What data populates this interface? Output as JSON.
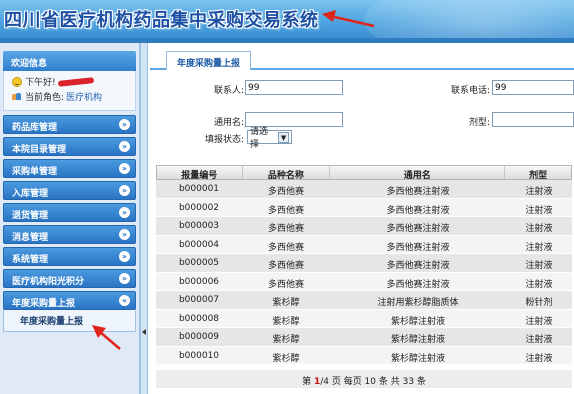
{
  "header": {
    "title": "四川省医疗机构药品集中采购交易系统"
  },
  "sidebar": {
    "welcome_title": "欢迎信息",
    "greeting": "下午好!",
    "role_label": "当前角色:",
    "role_value": "医疗机构",
    "menu": [
      {
        "label": "药品库管理"
      },
      {
        "label": "本院目录管理"
      },
      {
        "label": "采购单管理"
      },
      {
        "label": "入库管理"
      },
      {
        "label": "退货管理"
      },
      {
        "label": "消息管理"
      },
      {
        "label": "系统管理"
      },
      {
        "label": "医疗机构阳光积分"
      },
      {
        "label": "年度采购量上报"
      }
    ],
    "submenu_item": "年度采购量上报"
  },
  "main": {
    "tab": "年度采购量上报",
    "form": {
      "contact_label": "联系人:",
      "contact_value": "99",
      "phone_label": "联系电话:",
      "phone_value": "99",
      "generic_label": "通用名:",
      "generic_value": "",
      "dosage_label": "剂型:",
      "dosage_value": "",
      "status_label": "填报状态:",
      "status_value": "请选择"
    },
    "table": {
      "headers": [
        "报量编号",
        "品种名称",
        "通用名",
        "剂型"
      ],
      "rows": [
        [
          "b000001",
          "多西他赛",
          "多西他赛注射液",
          "注射液"
        ],
        [
          "b000002",
          "多西他赛",
          "多西他赛注射液",
          "注射液"
        ],
        [
          "b000003",
          "多西他赛",
          "多西他赛注射液",
          "注射液"
        ],
        [
          "b000004",
          "多西他赛",
          "多西他赛注射液",
          "注射液"
        ],
        [
          "b000005",
          "多西他赛",
          "多西他赛注射液",
          "注射液"
        ],
        [
          "b000006",
          "多西他赛",
          "多西他赛注射液",
          "注射液"
        ],
        [
          "b000007",
          "紫杉醇",
          "注射用紫杉醇脂质体",
          "粉针剂"
        ],
        [
          "b000008",
          "紫杉醇",
          "紫杉醇注射液",
          "注射液"
        ],
        [
          "b000009",
          "紫杉醇",
          "紫杉醇注射液",
          "注射液"
        ],
        [
          "b000010",
          "紫杉醇",
          "紫杉醇注射液",
          "注射液"
        ]
      ]
    },
    "pager": {
      "prefix": "第",
      "current": "1",
      "rest": "/4 页 每页 10 条 共 33 条"
    }
  },
  "colors": {
    "accent": "#2a74c4",
    "annotation": "#e0261c",
    "current_page": "#c01010"
  },
  "icons": [
    "smile-icon",
    "users-icon",
    "chevron-down-icon",
    "chevron-up-icon",
    "collapse-left-icon"
  ]
}
